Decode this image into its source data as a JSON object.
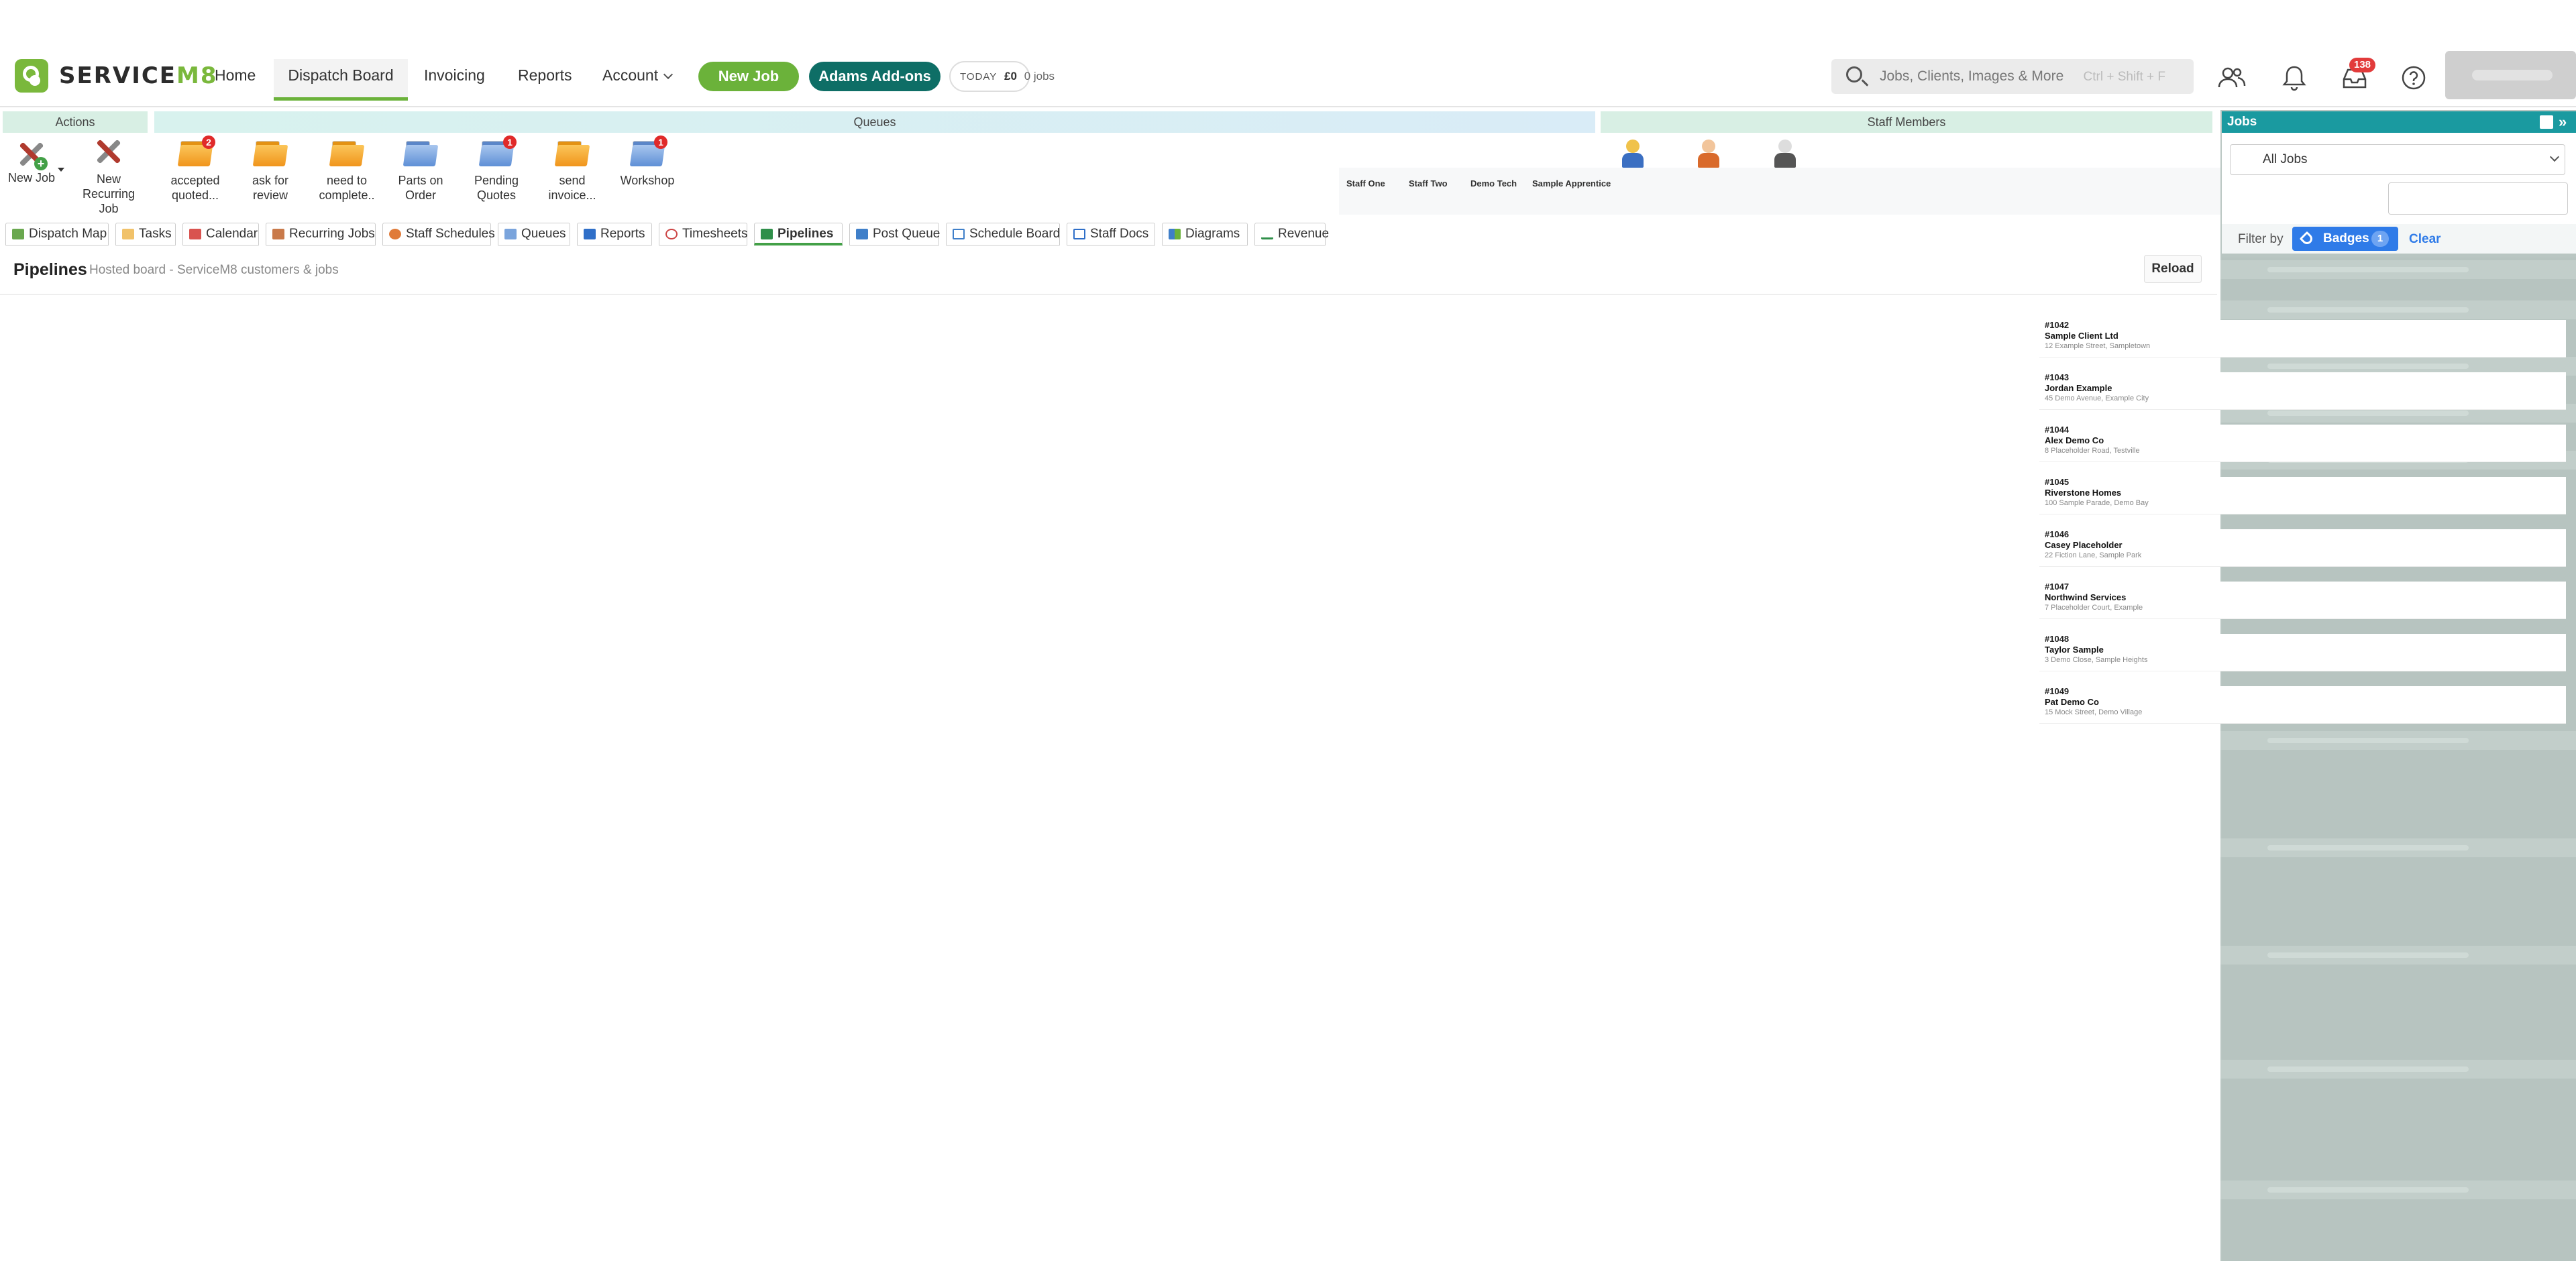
{
  "nav": {
    "logo_word": "SERVICE",
    "logo_suffix": "M8",
    "items": [
      "Home",
      "Dispatch Board",
      "Invoicing",
      "Reports",
      "Account"
    ],
    "new_job": "New Job",
    "addons": "Adams Add-ons",
    "today_label": "TODAY",
    "today_amount": "£0",
    "today_jobs": "0 jobs",
    "search_placeholder": "Jobs, Clients, Images & More",
    "search_shortcut": "Ctrl + Shift + F",
    "inbox_count": "138",
    "colors": {
      "green": "#6bb23a",
      "teal": "#0e6e66",
      "brand": "#7ab83c"
    }
  },
  "ribbon": {
    "actions_title": "Actions",
    "queues_title": "Queues",
    "staff_title": "Staff Members",
    "actions": [
      {
        "label": "New Job",
        "icon": "new-job-tools-icon"
      },
      {
        "label": "New Recurring Job",
        "icon": "recurring-job-tools-icon"
      }
    ],
    "queues": [
      {
        "label": "accepted quoted...",
        "badge": "2",
        "color": "orange"
      },
      {
        "label": "ask for review",
        "badge": "",
        "color": "orange"
      },
      {
        "label": "need to complete..",
        "badge": "",
        "color": "orange"
      },
      {
        "label": "Parts on Order",
        "badge": "",
        "color": "blue"
      },
      {
        "label": "Pending Quotes",
        "badge": "1",
        "color": "blue"
      },
      {
        "label": "send invoice...",
        "badge": "",
        "color": "orange"
      },
      {
        "label": "Workshop",
        "badge": "1",
        "color": "blue"
      }
    ],
    "staff": [
      "Staff One",
      "Staff Two",
      "Demo Tech",
      "Sample Apprentice"
    ]
  },
  "tabs": [
    {
      "label": "Dispatch Map",
      "icon": "map-icon"
    },
    {
      "label": "Tasks",
      "icon": "tasks-icon"
    },
    {
      "label": "Calendar",
      "icon": "calendar-icon"
    },
    {
      "label": "Recurring Jobs",
      "icon": "recurring-icon"
    },
    {
      "label": "Staff Schedules",
      "icon": "staff-icon"
    },
    {
      "label": "Queues",
      "icon": "folder-icon"
    },
    {
      "label": "Reports",
      "icon": "bar-chart-icon"
    },
    {
      "label": "Timesheets",
      "icon": "clock-icon"
    },
    {
      "label": "Pipelines",
      "icon": "pipeline-icon",
      "active": true
    },
    {
      "label": "Post Queue",
      "icon": "post-icon"
    },
    {
      "label": "Schedule Board",
      "icon": "board-icon"
    },
    {
      "label": "Staff Docs",
      "icon": "docs-icon"
    },
    {
      "label": "Diagrams",
      "icon": "diagram-icon"
    },
    {
      "label": "Revenue",
      "icon": "trend-icon"
    }
  ],
  "pipelines": {
    "title": "Pipelines",
    "subtitle": "Hosted board - ServiceM8 customers & jobs",
    "reload": "Reload",
    "jobs": [
      {
        "number": "#1042",
        "client": "Sample Client Ltd",
        "address": "12 Example Street, Sampletown"
      },
      {
        "number": "#1043",
        "client": "Jordan Example",
        "address": "45 Demo Avenue, Example City"
      },
      {
        "number": "#1044",
        "client": "Alex Demo Co",
        "address": "8 Placeholder Road, Testville"
      },
      {
        "number": "#1045",
        "client": "Riverstone Homes",
        "address": "100 Sample Parade, Demo Bay"
      },
      {
        "number": "#1046",
        "client": "Casey Placeholder",
        "address": "22 Fiction Lane, Sample Park"
      },
      {
        "number": "#1047",
        "client": "Northwind Services",
        "address": "7 Placeholder Court, Example"
      },
      {
        "number": "#1048",
        "client": "Taylor Sample",
        "address": "3 Demo Close, Sample Heights"
      },
      {
        "number": "#1049",
        "client": "Pat Demo Co",
        "address": "15 Mock Street, Demo Village"
      }
    ]
  },
  "jobs_panel": {
    "title": "Jobs",
    "filter_select": "All Jobs",
    "filter_by": "Filter by",
    "badges": "Badges",
    "badges_count": "1",
    "clear": "Clear",
    "colors": {
      "header": "#1a9aa0",
      "badge_btn": "#2f7be8"
    }
  }
}
